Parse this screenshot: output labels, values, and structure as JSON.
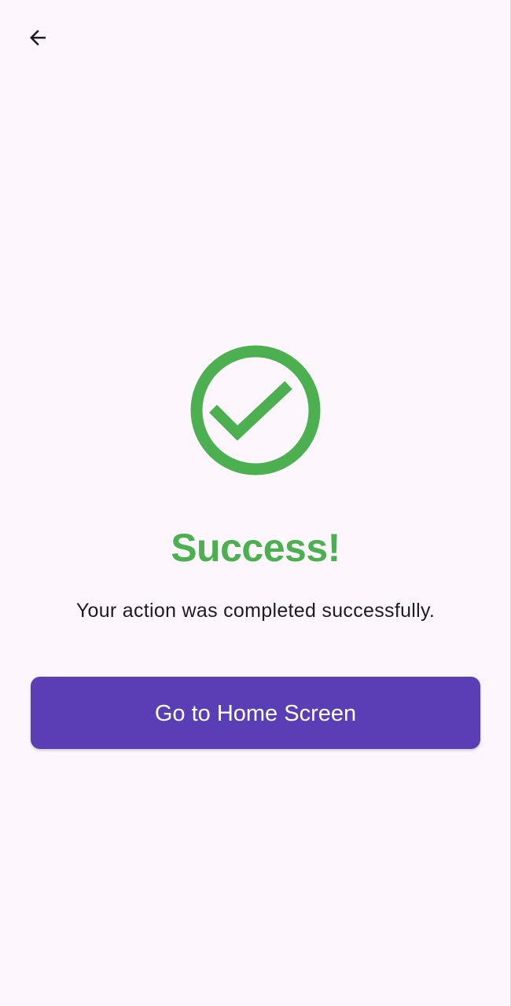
{
  "colors": {
    "background": "#fdf7fd",
    "success": "#4caf50",
    "primary": "#5a3eb5",
    "text": "#1e1a20",
    "icon": "#1c1b1f"
  },
  "header": {
    "back_icon": "arrow-back-icon"
  },
  "status": {
    "icon": "check-circle-icon",
    "title": "Success!",
    "message": "Your action was completed successfully."
  },
  "actions": {
    "home_label": "Go to Home Screen"
  }
}
